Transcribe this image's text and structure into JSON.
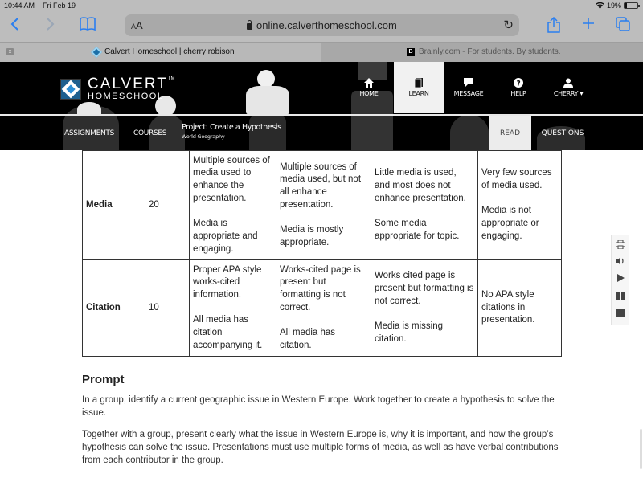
{
  "status_bar": {
    "time": "10:44 AM",
    "date": "Fri Feb 19",
    "battery": "19%",
    "battery_level": 0.19
  },
  "browser": {
    "aa_label": "AA",
    "url": "online.calverthomeschool.com",
    "tabs": [
      {
        "title": "Calvert Homeschool | cherry robison",
        "active": true,
        "close_label": "x"
      },
      {
        "title": "Brainly.com - For students. By students.",
        "active": false,
        "favicon_letter": "B"
      }
    ]
  },
  "site": {
    "logo": {
      "line1": "CALVERT",
      "tm": "TM",
      "line2": "HOMESCHOOL"
    },
    "nav": [
      {
        "label": "HOME",
        "icon": "home-icon"
      },
      {
        "label": "LEARN",
        "icon": "book-icon",
        "active": true
      },
      {
        "label": "MESSAGE",
        "icon": "message-icon"
      },
      {
        "label": "HELP",
        "icon": "help-icon"
      },
      {
        "label": "CHERRY",
        "icon": "user-icon",
        "dropdown": true
      }
    ],
    "subnav": {
      "assignments": "ASSIGNMENTS",
      "courses": "COURSES",
      "project_title": "Project: Create a Hypothesis",
      "project_subject": "World Geography",
      "read": "READ",
      "questions": "QUESTIONS"
    }
  },
  "rubric": {
    "rows": [
      {
        "criterion": "Media",
        "points": "20",
        "levels": [
          [
            "Multiple sources of media used to enhance the presentation.",
            "Media is appropriate and engaging."
          ],
          [
            "Multiple sources of media used, but not all enhance presentation.",
            "Media is mostly appropriate."
          ],
          [
            "Little media is used, and most does not enhance presentation.",
            "Some media appropriate for topic."
          ],
          [
            "Very few sources of media used.",
            "Media is not appropriate or engaging."
          ]
        ]
      },
      {
        "criterion": "Citation",
        "points": "10",
        "levels": [
          [
            "Proper APA style works-cited information.",
            "All media has citation accompanying it."
          ],
          [
            "Works-cited page is present but formatting is not correct.",
            "All media has citation."
          ],
          [
            "Works cited page is present but formatting is not correct.",
            "Media is missing citation."
          ],
          [
            "No APA style citations in presentation."
          ]
        ]
      }
    ]
  },
  "prompt": {
    "heading": "Prompt",
    "paragraphs": [
      "In a group, identify a current geographic issue in Western Europe. Work together to create a hypothesis to solve the issue.",
      "Together with a group, present clearly what the issue in Western Europe is, why it is important, and how the group’s hypothesis can solve the issue. Presentations must use multiple forms of media, as well as have verbal contributions from each contributor in the group."
    ]
  },
  "side_tools": [
    "print-icon",
    "speaker-icon",
    "play-icon",
    "pause-icon",
    "stop-icon"
  ]
}
